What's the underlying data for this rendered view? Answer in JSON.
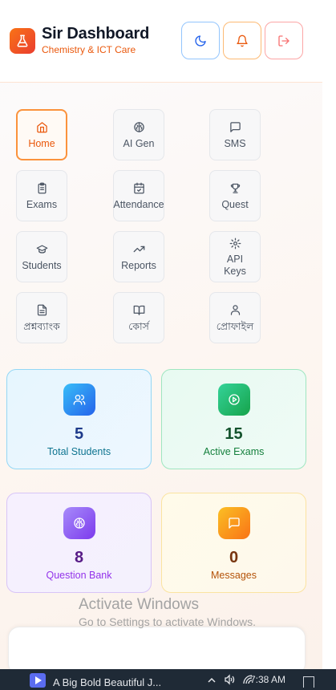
{
  "header": {
    "title": "Sir Dashboard",
    "subtitle": "Chemistry & ICT Care",
    "logo_icon": "flask-icon",
    "buttons": [
      {
        "name": "theme-toggle",
        "icon": "moon-icon",
        "color": "#2563eb"
      },
      {
        "name": "notifications",
        "icon": "bell-icon",
        "color": "#ea580c"
      },
      {
        "name": "logout",
        "icon": "logout-icon",
        "color": "#f87171"
      }
    ]
  },
  "nav": {
    "items": [
      {
        "label": "Home",
        "icon": "home-icon",
        "active": true
      },
      {
        "label": "AI Gen",
        "icon": "brain-icon"
      },
      {
        "label": "SMS",
        "icon": "message-square-icon"
      },
      {
        "label": "Exams",
        "icon": "clipboard-icon"
      },
      {
        "label": "Attendance",
        "icon": "calendar-check-icon"
      },
      {
        "label": "Quest",
        "icon": "trophy-icon"
      },
      {
        "label": "Students",
        "icon": "graduation-cap-icon"
      },
      {
        "label": "Reports",
        "icon": "trending-up-icon"
      },
      {
        "label": "API Keys",
        "icon": "gear-icon"
      },
      {
        "label": "প্রশ্নব্যাংক",
        "icon": "file-text-icon"
      },
      {
        "label": "কোর্স",
        "icon": "book-open-icon"
      },
      {
        "label": "প্রোফাইল",
        "icon": "user-icon"
      }
    ]
  },
  "stats": [
    {
      "value": "5",
      "label": "Total Students",
      "icon": "users-icon",
      "accent": "#2563eb"
    },
    {
      "value": "15",
      "label": "Active Exams",
      "icon": "play-circle-icon",
      "accent": "#16a34a"
    },
    {
      "value": "8",
      "label": "Question Bank",
      "icon": "brain-icon",
      "accent": "#7c3aed"
    },
    {
      "value": "0",
      "label": "Messages",
      "icon": "message-square-icon",
      "accent": "#f97316"
    }
  ],
  "watermark": {
    "title": "Activate Windows",
    "subtitle": "Go to Settings to activate Windows."
  },
  "taskbar": {
    "app_title": "A Big Bold Beautiful J...",
    "clock": "7:38 AM"
  }
}
